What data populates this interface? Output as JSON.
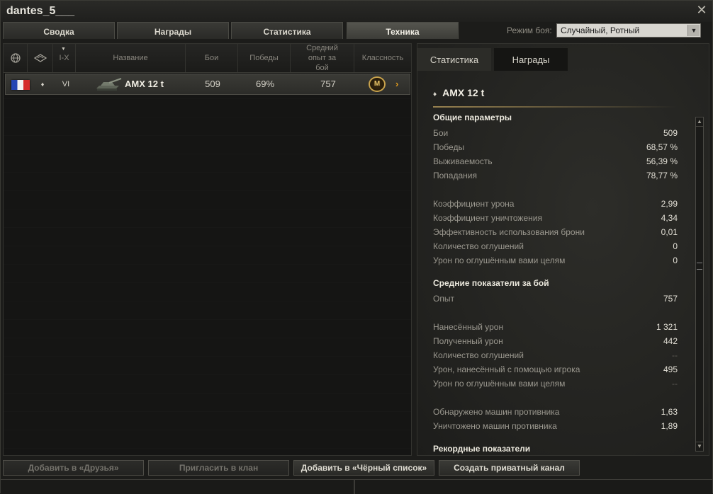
{
  "window": {
    "title": "dantes_5___",
    "close_icon": "close-icon"
  },
  "tabs": [
    {
      "label": "Сводка",
      "active": false
    },
    {
      "label": "Награды",
      "active": false
    },
    {
      "label": "Статистика",
      "active": false
    },
    {
      "label": "Техника",
      "active": true
    }
  ],
  "battle_mode": {
    "label": "Режим боя:",
    "value": "Случайный, Ротный"
  },
  "table": {
    "headers": {
      "nation_icon": "globe-icon",
      "type_icon": "vehicle-type-icon",
      "tier": "I-X",
      "name": "Название",
      "battles": "Бои",
      "wins": "Победы",
      "avg_xp": "Средний опыт за бой",
      "mastery": "Классность"
    },
    "rows": [
      {
        "nation": "france-flag-icon",
        "type_icon": "light-tank-icon",
        "tier": "VI",
        "name": "AMX 12 t",
        "battles": "509",
        "wins": "69%",
        "avg_xp": "757",
        "mastery": "M"
      }
    ]
  },
  "details": {
    "tabs": [
      {
        "label": "Статистика",
        "active": true
      },
      {
        "label": "Награды",
        "active": false
      }
    ],
    "tank_name": "AMX 12 t",
    "tier_icon": "light-tank-icon",
    "sections": [
      {
        "title": "Общие параметры",
        "rows": [
          {
            "label": "Бои",
            "value": "509"
          },
          {
            "label": "Победы",
            "value": "68,57 %"
          },
          {
            "label": "Выживаемость",
            "value": "56,39 %"
          },
          {
            "label": "Попадания",
            "value": "78,77 %"
          },
          {
            "label": "Коэффициент урона",
            "value": "2,99"
          },
          {
            "label": "Коэффициент уничтожения",
            "value": "4,34"
          },
          {
            "label": "Эффективность использования брони",
            "value": "0,01"
          },
          {
            "label": "Количество оглушений",
            "value": "0"
          },
          {
            "label": "Урон по оглушённым вами целям",
            "value": "0"
          }
        ]
      },
      {
        "title": "Средние показатели за бой",
        "rows": [
          {
            "label": "Опыт",
            "value": "757"
          },
          {
            "label": "Нанесённый урон",
            "value": "1 321"
          },
          {
            "label": "Полученный урон",
            "value": "442"
          },
          {
            "label": "Количество оглушений",
            "value": "--"
          },
          {
            "label": "Урон, нанесённый с помощью игрока",
            "value": "495"
          },
          {
            "label": "Урон по оглушённым вами целям",
            "value": "--"
          },
          {
            "label": "Обнаружено машин противника",
            "value": "1,63"
          },
          {
            "label": "Уничтожено машин противника",
            "value": "1,89"
          }
        ]
      },
      {
        "title": "Рекордные показатели",
        "rows": []
      }
    ]
  },
  "buttons": [
    {
      "label": "Добавить в «Друзья»",
      "enabled": false
    },
    {
      "label": "Пригласить в клан",
      "enabled": false
    },
    {
      "label": "Добавить в «Чёрный список»",
      "enabled": true
    },
    {
      "label": "Создать приватный канал",
      "enabled": true
    }
  ]
}
